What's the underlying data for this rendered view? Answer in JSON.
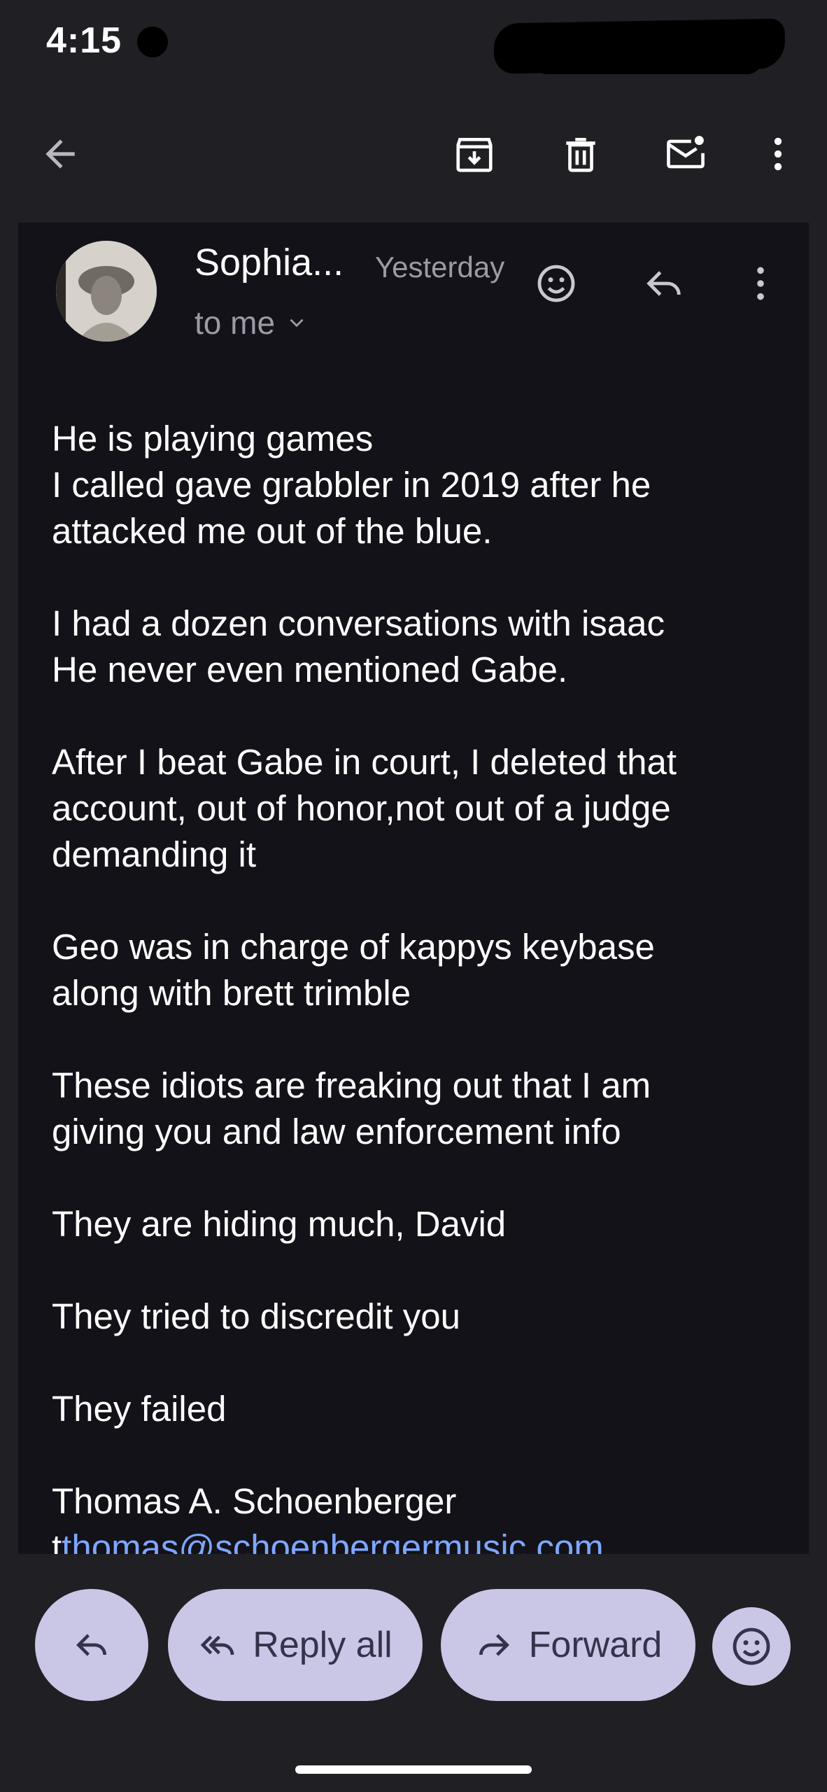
{
  "status_bar": {
    "time": "4:15",
    "indicator": "v"
  },
  "toolbar": {
    "back_icon": "arrow-left-icon",
    "archive_icon": "archive-icon",
    "delete_icon": "trash-icon",
    "mark_unread_icon": "mail-unread-icon",
    "more_icon": "more-vert-icon"
  },
  "message": {
    "sender": "Sophia...",
    "time": "Yesterday",
    "recipient": "to me",
    "paragraphs": [
      [
        "He is playing games",
        "I called gave grabbler in 2019 after he",
        "attacked me out of the blue."
      ],
      [
        "I had a dozen conversations with isaac",
        "He never even mentioned Gabe."
      ],
      [
        "After I beat Gabe in court, I deleted that",
        "account, out of honor,not out of a judge",
        "demanding it"
      ],
      [
        "Geo was in charge of kappys keybase",
        "along with brett trimble"
      ],
      [
        "These idiots are freaking out that I am",
        "giving you and law enforcement info"
      ],
      [
        "They are hiding much, David"
      ],
      [
        "They tried to discredit you"
      ],
      [
        "They failed"
      ]
    ],
    "signature_name": "Thomas A. Schoenberger",
    "signature_email_prefix": "t",
    "signature_email": "thomas@schoenbergermusic.com"
  },
  "actions": {
    "reply_label": "",
    "reply_all_label": "Reply all",
    "forward_label": "Forward",
    "emoji_icon": "emoji-icon"
  },
  "colors": {
    "background": "#1f1f24",
    "card": "#131218",
    "pill": "#cac6e6",
    "pill_text": "#35334a",
    "link": "#7ea7ff",
    "muted": "#9c9aa6"
  }
}
